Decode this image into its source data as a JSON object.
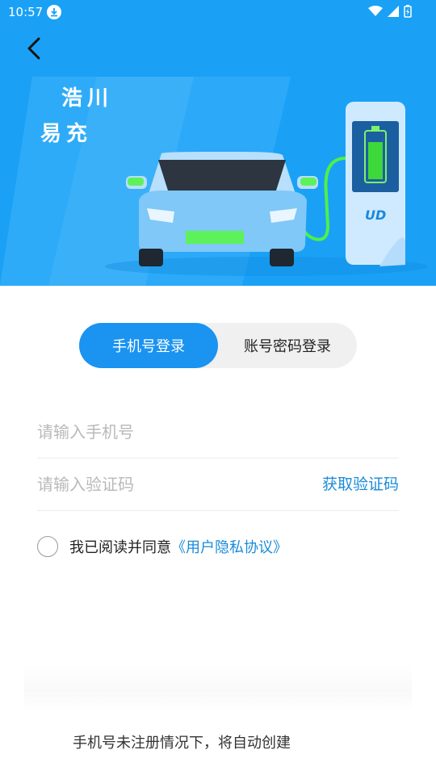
{
  "status_bar": {
    "time": "10:57"
  },
  "brand": {
    "line1": "浩川",
    "line2": "易充"
  },
  "charger": {
    "logo_text": "UD"
  },
  "login_tabs": [
    {
      "label": "手机号登录",
      "active": true
    },
    {
      "label": "账号密码登录",
      "active": false
    }
  ],
  "phone_field": {
    "placeholder": "请输入手机号",
    "value": ""
  },
  "code_field": {
    "placeholder": "请输入验证码",
    "value": ""
  },
  "get_code_label": "获取验证码",
  "agreement": {
    "text": "我已阅读并同意",
    "link": "《用户隐私协议》",
    "checked": false
  },
  "bottom_note": "手机号未注册情况下，将自动创建",
  "colors": {
    "hero_bg": "#1aa1f6",
    "tab_active": "#1a93f1",
    "link": "#1a8bd8"
  }
}
